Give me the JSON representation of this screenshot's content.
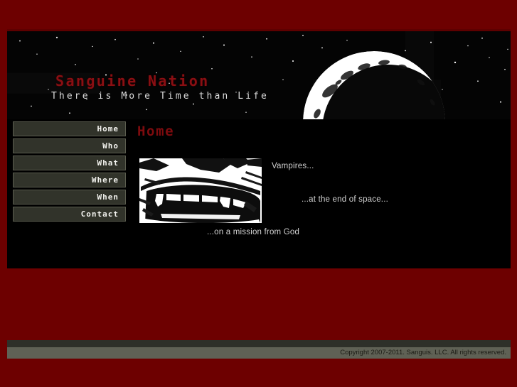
{
  "site": {
    "title": "Sanguine Nation",
    "tagline": "There is More Time than Life"
  },
  "colors": {
    "page_background": "#6d0000",
    "content_background": "#000000",
    "accent_red": "#8a0f13",
    "heading_red": "#7d0b0e",
    "nav_fill": "#31332a",
    "nav_border": "#5b5d4f",
    "nav_text": "#f2f2ee",
    "footer_bar": "#5f6155",
    "footer_dark": "#2e3029",
    "body_text": "#d2d2d2"
  },
  "nav": {
    "items": [
      {
        "label": "Home"
      },
      {
        "label": "Who"
      },
      {
        "label": "What"
      },
      {
        "label": "Where"
      },
      {
        "label": "When"
      },
      {
        "label": "Contact"
      }
    ]
  },
  "main": {
    "heading": "Home",
    "image_alt": "vampire-mouth-fangs",
    "lines": {
      "first": "Vampires...",
      "second": "...at the end of space...",
      "third": "...on a mission from God"
    }
  },
  "footer": {
    "copyright": "Copyright 2007-2011. Sanguis. LLC. All rights reserved."
  },
  "header_art": {
    "moon": "crescent-moon",
    "stars": "starfield"
  }
}
